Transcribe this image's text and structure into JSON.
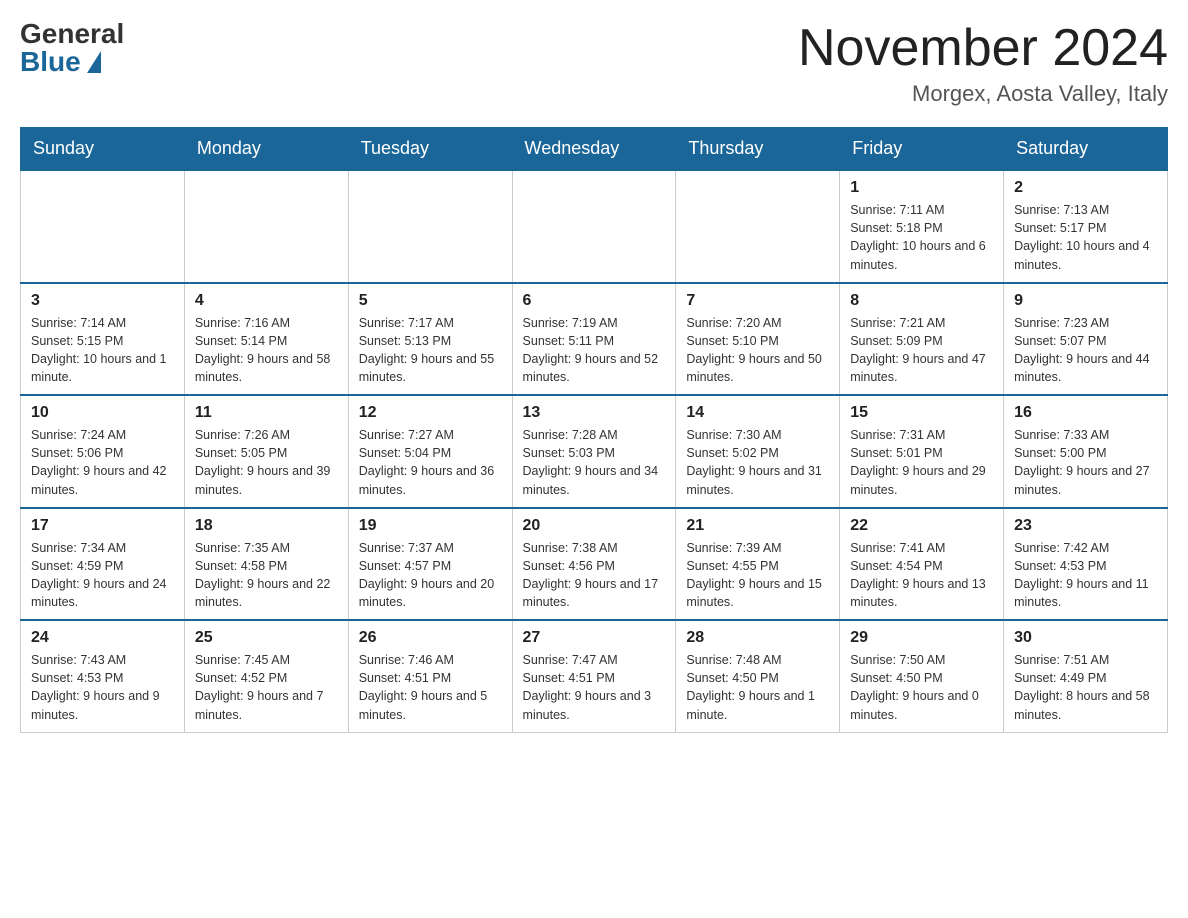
{
  "header": {
    "logo_general": "General",
    "logo_blue": "Blue",
    "month_title": "November 2024",
    "location": "Morgex, Aosta Valley, Italy"
  },
  "days_of_week": [
    "Sunday",
    "Monday",
    "Tuesday",
    "Wednesday",
    "Thursday",
    "Friday",
    "Saturday"
  ],
  "weeks": [
    [
      {
        "day": "",
        "info": ""
      },
      {
        "day": "",
        "info": ""
      },
      {
        "day": "",
        "info": ""
      },
      {
        "day": "",
        "info": ""
      },
      {
        "day": "",
        "info": ""
      },
      {
        "day": "1",
        "info": "Sunrise: 7:11 AM\nSunset: 5:18 PM\nDaylight: 10 hours and 6 minutes."
      },
      {
        "day": "2",
        "info": "Sunrise: 7:13 AM\nSunset: 5:17 PM\nDaylight: 10 hours and 4 minutes."
      }
    ],
    [
      {
        "day": "3",
        "info": "Sunrise: 7:14 AM\nSunset: 5:15 PM\nDaylight: 10 hours and 1 minute."
      },
      {
        "day": "4",
        "info": "Sunrise: 7:16 AM\nSunset: 5:14 PM\nDaylight: 9 hours and 58 minutes."
      },
      {
        "day": "5",
        "info": "Sunrise: 7:17 AM\nSunset: 5:13 PM\nDaylight: 9 hours and 55 minutes."
      },
      {
        "day": "6",
        "info": "Sunrise: 7:19 AM\nSunset: 5:11 PM\nDaylight: 9 hours and 52 minutes."
      },
      {
        "day": "7",
        "info": "Sunrise: 7:20 AM\nSunset: 5:10 PM\nDaylight: 9 hours and 50 minutes."
      },
      {
        "day": "8",
        "info": "Sunrise: 7:21 AM\nSunset: 5:09 PM\nDaylight: 9 hours and 47 minutes."
      },
      {
        "day": "9",
        "info": "Sunrise: 7:23 AM\nSunset: 5:07 PM\nDaylight: 9 hours and 44 minutes."
      }
    ],
    [
      {
        "day": "10",
        "info": "Sunrise: 7:24 AM\nSunset: 5:06 PM\nDaylight: 9 hours and 42 minutes."
      },
      {
        "day": "11",
        "info": "Sunrise: 7:26 AM\nSunset: 5:05 PM\nDaylight: 9 hours and 39 minutes."
      },
      {
        "day": "12",
        "info": "Sunrise: 7:27 AM\nSunset: 5:04 PM\nDaylight: 9 hours and 36 minutes."
      },
      {
        "day": "13",
        "info": "Sunrise: 7:28 AM\nSunset: 5:03 PM\nDaylight: 9 hours and 34 minutes."
      },
      {
        "day": "14",
        "info": "Sunrise: 7:30 AM\nSunset: 5:02 PM\nDaylight: 9 hours and 31 minutes."
      },
      {
        "day": "15",
        "info": "Sunrise: 7:31 AM\nSunset: 5:01 PM\nDaylight: 9 hours and 29 minutes."
      },
      {
        "day": "16",
        "info": "Sunrise: 7:33 AM\nSunset: 5:00 PM\nDaylight: 9 hours and 27 minutes."
      }
    ],
    [
      {
        "day": "17",
        "info": "Sunrise: 7:34 AM\nSunset: 4:59 PM\nDaylight: 9 hours and 24 minutes."
      },
      {
        "day": "18",
        "info": "Sunrise: 7:35 AM\nSunset: 4:58 PM\nDaylight: 9 hours and 22 minutes."
      },
      {
        "day": "19",
        "info": "Sunrise: 7:37 AM\nSunset: 4:57 PM\nDaylight: 9 hours and 20 minutes."
      },
      {
        "day": "20",
        "info": "Sunrise: 7:38 AM\nSunset: 4:56 PM\nDaylight: 9 hours and 17 minutes."
      },
      {
        "day": "21",
        "info": "Sunrise: 7:39 AM\nSunset: 4:55 PM\nDaylight: 9 hours and 15 minutes."
      },
      {
        "day": "22",
        "info": "Sunrise: 7:41 AM\nSunset: 4:54 PM\nDaylight: 9 hours and 13 minutes."
      },
      {
        "day": "23",
        "info": "Sunrise: 7:42 AM\nSunset: 4:53 PM\nDaylight: 9 hours and 11 minutes."
      }
    ],
    [
      {
        "day": "24",
        "info": "Sunrise: 7:43 AM\nSunset: 4:53 PM\nDaylight: 9 hours and 9 minutes."
      },
      {
        "day": "25",
        "info": "Sunrise: 7:45 AM\nSunset: 4:52 PM\nDaylight: 9 hours and 7 minutes."
      },
      {
        "day": "26",
        "info": "Sunrise: 7:46 AM\nSunset: 4:51 PM\nDaylight: 9 hours and 5 minutes."
      },
      {
        "day": "27",
        "info": "Sunrise: 7:47 AM\nSunset: 4:51 PM\nDaylight: 9 hours and 3 minutes."
      },
      {
        "day": "28",
        "info": "Sunrise: 7:48 AM\nSunset: 4:50 PM\nDaylight: 9 hours and 1 minute."
      },
      {
        "day": "29",
        "info": "Sunrise: 7:50 AM\nSunset: 4:50 PM\nDaylight: 9 hours and 0 minutes."
      },
      {
        "day": "30",
        "info": "Sunrise: 7:51 AM\nSunset: 4:49 PM\nDaylight: 8 hours and 58 minutes."
      }
    ]
  ]
}
